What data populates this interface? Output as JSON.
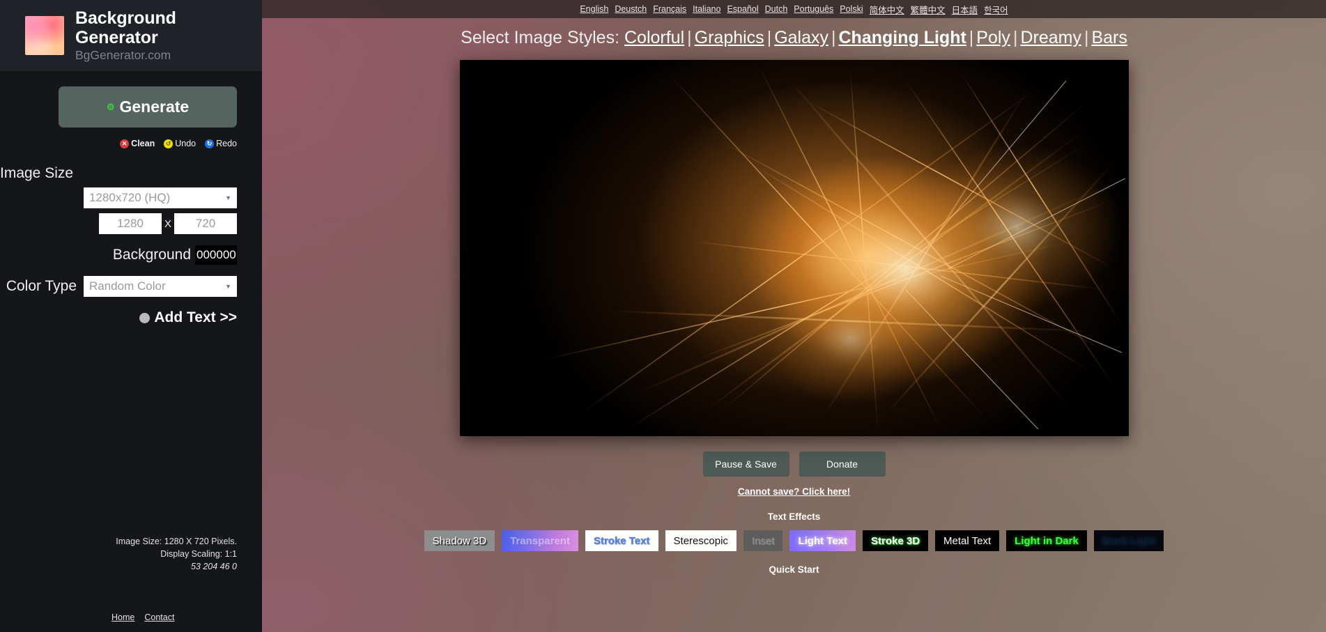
{
  "languages": [
    "English",
    "Deustch",
    "Français",
    "Italiano",
    "Español",
    "Dutch",
    "Português",
    "Polski",
    "简体中文",
    "繁體中文",
    "日本語",
    "한국어"
  ],
  "sidebar": {
    "brand_title": "Background Generator",
    "brand_subtitle": "BgGenerator.com",
    "generate_label": "Generate",
    "generate_icon": "gear-icon",
    "actions": [
      {
        "label": "Clean",
        "icon": "close-circle-icon",
        "color": "#e03b3b",
        "glyph": "✕",
        "bold": true
      },
      {
        "label": "Undo",
        "icon": "undo-circle-icon",
        "color": "#ece000",
        "glyph": "↺",
        "bold": false
      },
      {
        "label": "Redo",
        "icon": "redo-circle-icon",
        "color": "#1f6fe0",
        "glyph": "↻",
        "bold": false
      }
    ],
    "image_size_label": "Image Size",
    "preset_value": "1280x720 (HQ)",
    "width_value": "1280",
    "height_value": "720",
    "x_separator": "X",
    "background_label": "Background",
    "background_hex": "000000",
    "color_type_label": "Color Type",
    "color_type_value": "Random Color",
    "add_text_label": "Add Text >>",
    "info_line1": "Image Size: 1280 X 720 Pixels.",
    "info_line2": "Display Scaling: 1:1",
    "info_line3": "53 204 46 0",
    "footer_links": [
      "Home",
      "Contact"
    ]
  },
  "main": {
    "styles_title": "Select Image Styles:",
    "styles": [
      {
        "label": "Colorful",
        "active": false
      },
      {
        "label": "Graphics",
        "active": false
      },
      {
        "label": "Galaxy",
        "active": false
      },
      {
        "label": "Changing Light",
        "active": true
      },
      {
        "label": "Poly",
        "active": false
      },
      {
        "label": "Dreamy",
        "active": false
      },
      {
        "label": "Bars",
        "active": false
      }
    ],
    "pause_save_label": "Pause & Save",
    "donate_label": "Donate",
    "cannot_save_label": "Cannot save? Click here!",
    "text_effects_label": "Text Effects",
    "quick_start_label": "Quick Start",
    "effects": [
      {
        "label": "Shadow 3D",
        "class": "eff-shadow3d"
      },
      {
        "label": "Transparent",
        "class": "eff-transparent"
      },
      {
        "label": "Stroke Text",
        "class": "eff-stroke-text"
      },
      {
        "label": "Sterescopic",
        "class": "eff-sterescopic"
      },
      {
        "label": "Inset",
        "class": "eff-inset"
      },
      {
        "label": "Light Text",
        "class": "eff-light-text"
      },
      {
        "label": "Stroke 3D",
        "class": "eff-stroke-3d"
      },
      {
        "label": "Metal Text",
        "class": "eff-metal-text"
      },
      {
        "label": "Light in Dark",
        "class": "eff-light-in-dark"
      },
      {
        "label": "Back Light",
        "class": "eff-back-light"
      }
    ]
  },
  "colors": {
    "sidebar_bg": "#14161a",
    "brand_bg": "#1f2227",
    "generate_btn": "#56645f",
    "action_btn": "#4d5a55",
    "canvas_bg": "#000000",
    "art_primary": "#ff9b32",
    "art_highlight": "#ffd98c"
  }
}
